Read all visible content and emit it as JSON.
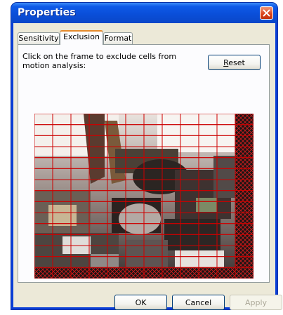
{
  "window": {
    "title": "Properties"
  },
  "tabs": [
    {
      "label": "Sensitivity",
      "active": false
    },
    {
      "label": "Exclusion",
      "active": true
    },
    {
      "label": "Format",
      "active": false
    }
  ],
  "exclusion": {
    "instruction": "Click on the frame to exclude cells from motion analysis:",
    "reset_label_underlined": "R",
    "reset_label_rest": "eset",
    "grid": {
      "columns": 12,
      "rows": 15,
      "excluded_columns": [
        11
      ],
      "excluded_rows": [
        14
      ]
    }
  },
  "footer": {
    "ok_label": "OK",
    "cancel_label": "Cancel",
    "apply_label": "Apply",
    "apply_enabled": false
  },
  "colors": {
    "title_bar": "#0a4fd9",
    "grid_line": "#cc0000",
    "active_tab_accent": "#e68b2c",
    "face": "#ece9d8"
  }
}
